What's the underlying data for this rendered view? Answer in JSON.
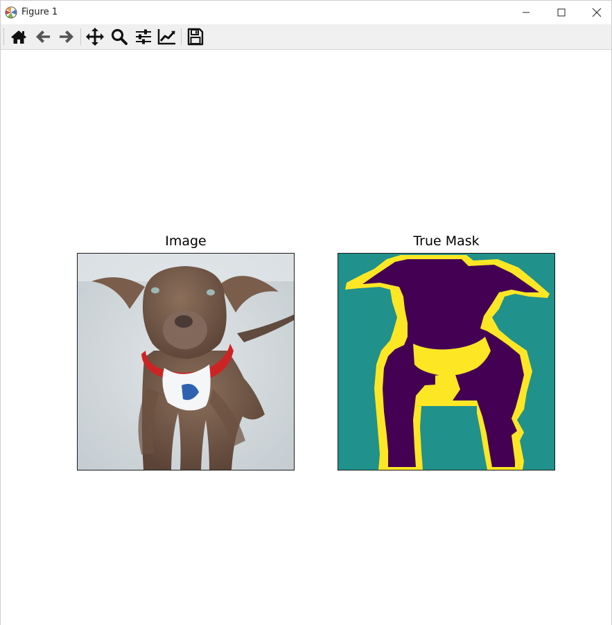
{
  "window": {
    "title": "Figure 1",
    "icons": {
      "app": "matplotlib-icon",
      "minimize": "minimize-icon",
      "maximize": "maximize-icon",
      "close": "close-icon"
    }
  },
  "toolbar": {
    "buttons": [
      {
        "name": "home",
        "icon": "home-icon"
      },
      {
        "name": "back",
        "icon": "arrow-left-icon"
      },
      {
        "name": "forward",
        "icon": "arrow-right-icon"
      },
      {
        "name": "pan",
        "icon": "move-icon"
      },
      {
        "name": "zoom",
        "icon": "magnifier-icon"
      },
      {
        "name": "configure-subplots",
        "icon": "sliders-icon"
      },
      {
        "name": "edit-axes",
        "icon": "line-chart-icon"
      },
      {
        "name": "save",
        "icon": "floppy-disk-icon"
      }
    ]
  },
  "figure": {
    "subplots": [
      {
        "title": "Image",
        "content": "photo of a brown dog wearing a red collar sitting on carpet"
      },
      {
        "title": "True Mask",
        "content": "segmentation mask"
      }
    ],
    "colors": {
      "mask_background": "#21918c",
      "mask_foreground": "#440154",
      "mask_border": "#fde725"
    }
  }
}
